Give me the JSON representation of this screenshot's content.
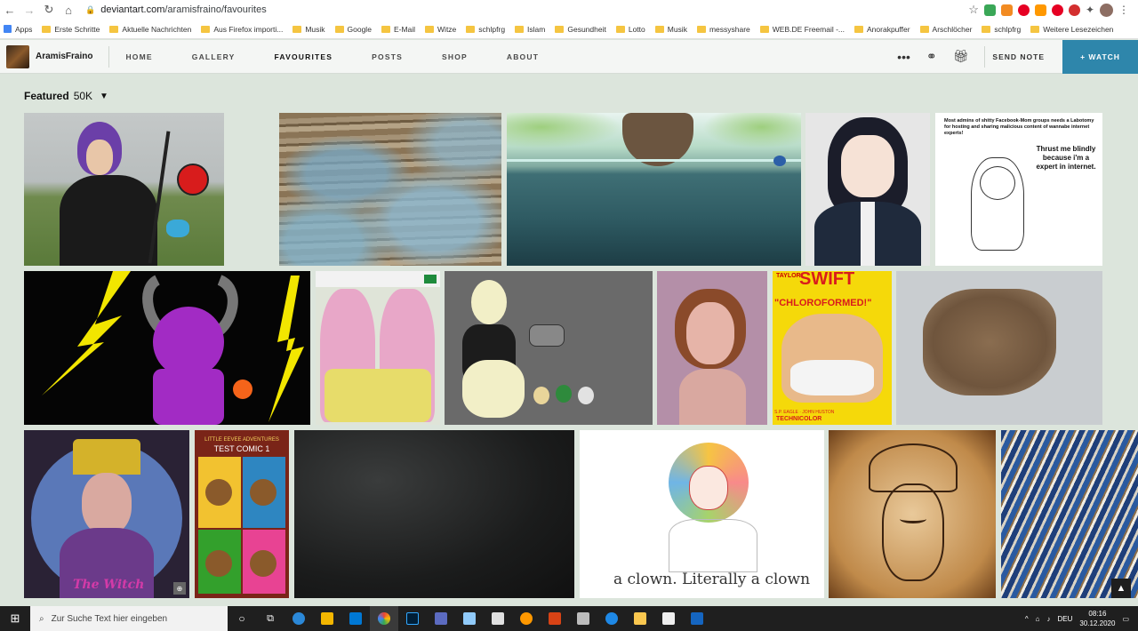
{
  "browser": {
    "url_host": "deviantart.com",
    "url_path": "/aramisfraino/favourites"
  },
  "bookmarks": [
    "Apps",
    "Erste Schritte",
    "Aktuelle Nachrichten",
    "Aus Firefox importi...",
    "Musik",
    "Google",
    "E-Mail",
    "Witze",
    "schlpfrg",
    "Islam",
    "Gesundheit",
    "Lotto",
    "Musik",
    "messyshare",
    "WEB.DE Freemail -...",
    "Anorakpuffer",
    "Arschlöcher",
    "schlpfrg",
    "Weitere Lesezeichen"
  ],
  "header": {
    "username": "AramisFraino",
    "nav": [
      "HOME",
      "GALLERY",
      "FAVOURITES",
      "POSTS",
      "SHOP",
      "ABOUT"
    ],
    "send_note": "SEND NOTE",
    "watch": "+ WATCH"
  },
  "featured": {
    "label": "Featured",
    "count": "50K"
  },
  "meme": {
    "header": "Most admins of shitty Facebook-Mom groups needs a Labotomy for hosting and sharing malicious content of wannabe internet experts!",
    "bubble": "Thrust me blindly because i'm a expert in internet."
  },
  "poster": {
    "artist": "TAYLOR",
    "title": "SWIFT",
    "subtitle": "\"CHLOROFORMED!\"",
    "footer": "TECHNICOLOR",
    "credits": "S.P. EAGLE · JOHN HUSTON"
  },
  "comic": {
    "title": "LITTLE EEVEE ADVENTURES",
    "subtitle": "TEST COMIC 1"
  },
  "witch": {
    "caption": "The Witch"
  },
  "clown": {
    "caption": "a clown. Literally a clown"
  },
  "taskbar": {
    "search_placeholder": "Zur Suche Text hier eingeben",
    "lang": "DEU",
    "time": "08:16",
    "date": "30.12.2020"
  }
}
